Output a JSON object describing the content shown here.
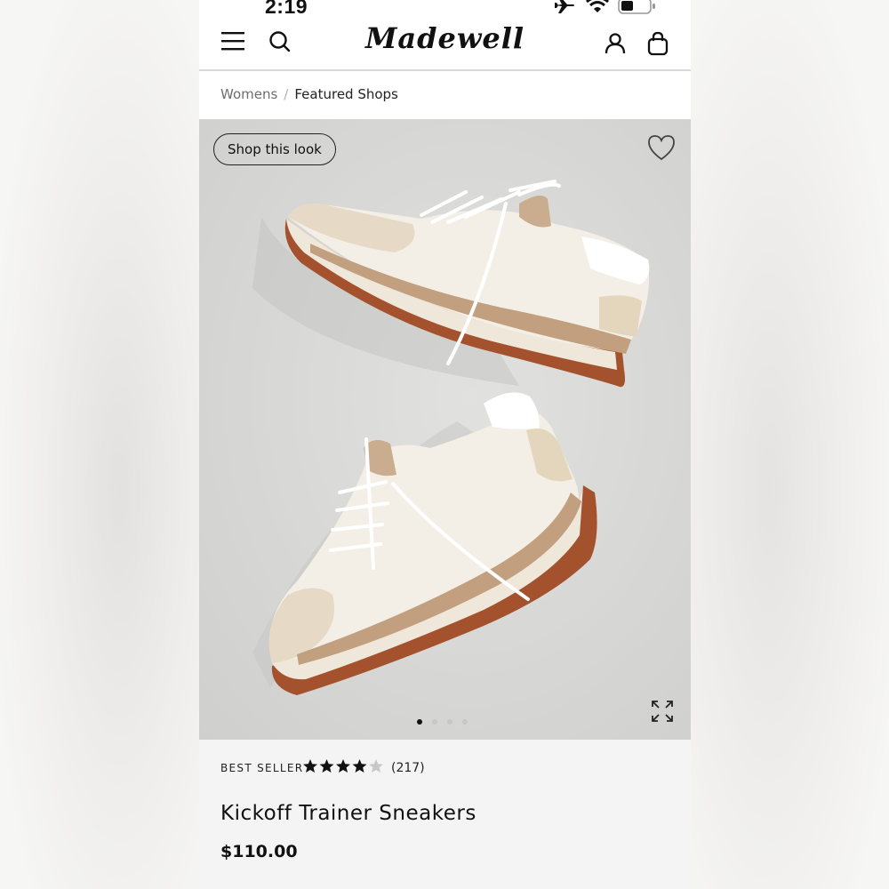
{
  "status_bar": {
    "time": "2:19"
  },
  "header": {
    "logo": "Madewell"
  },
  "breadcrumb": {
    "items": [
      "Womens",
      "Featured Shops"
    ],
    "separator": "/"
  },
  "gallery": {
    "shop_look_label": "Shop this look",
    "image_count": 4,
    "active_image_index": 0
  },
  "product": {
    "badge": "BEST SELLER",
    "rating": 4,
    "rating_max": 5,
    "review_count": "(217)",
    "name": "Kickoff Trainer Sneakers",
    "price": "$110.00"
  },
  "colors": {
    "page_bg": "#ffffff",
    "gallery_bg": "#d8d8d6",
    "info_bg": "#f4f4f4",
    "text": "#111111",
    "sole": "#a4522e",
    "tan_stripe": "#c2a07f",
    "suede": "#e6dac6",
    "shoe_upper": "#f3efe6"
  },
  "icons": [
    "airplane-icon",
    "wifi-icon",
    "battery-icon",
    "menu-icon",
    "search-icon",
    "account-icon",
    "bag-icon",
    "heart-icon",
    "expand-icon",
    "star-icon"
  ]
}
